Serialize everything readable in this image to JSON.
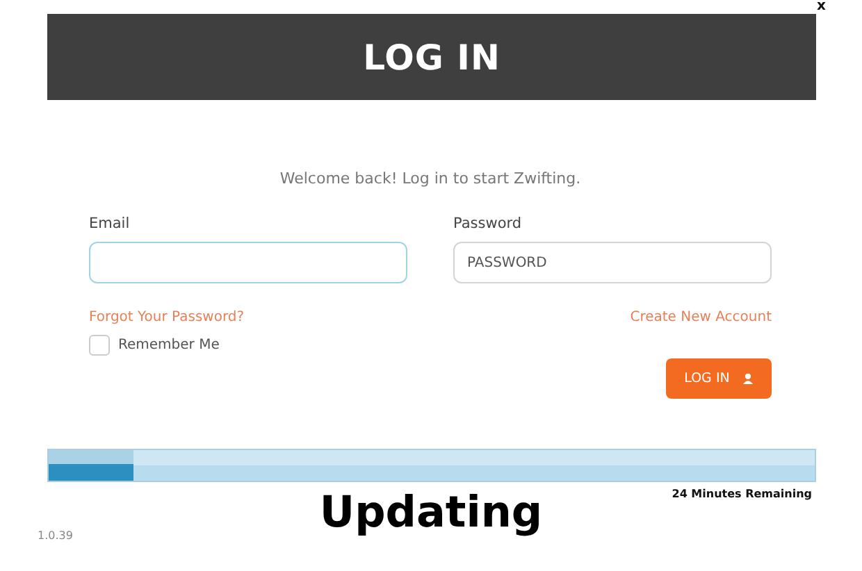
{
  "window": {
    "close": "x"
  },
  "header": {
    "title": "LOG IN"
  },
  "form": {
    "welcome": "Welcome back! Log in to start Zwifting.",
    "email": {
      "label": "Email",
      "focused": true
    },
    "password": {
      "label": "Password",
      "placeholder": "PASSWORD",
      "focused": false
    },
    "forgot_link": "Forgot Your Password?",
    "create_link": "Create New Account",
    "remember": {
      "label": "Remember Me",
      "checked": false
    },
    "login_button": "LOG IN"
  },
  "update": {
    "level": 0.11,
    "remaining": "24 Minutes Remaining",
    "status": "Updating"
  },
  "version": "1.0.39"
}
